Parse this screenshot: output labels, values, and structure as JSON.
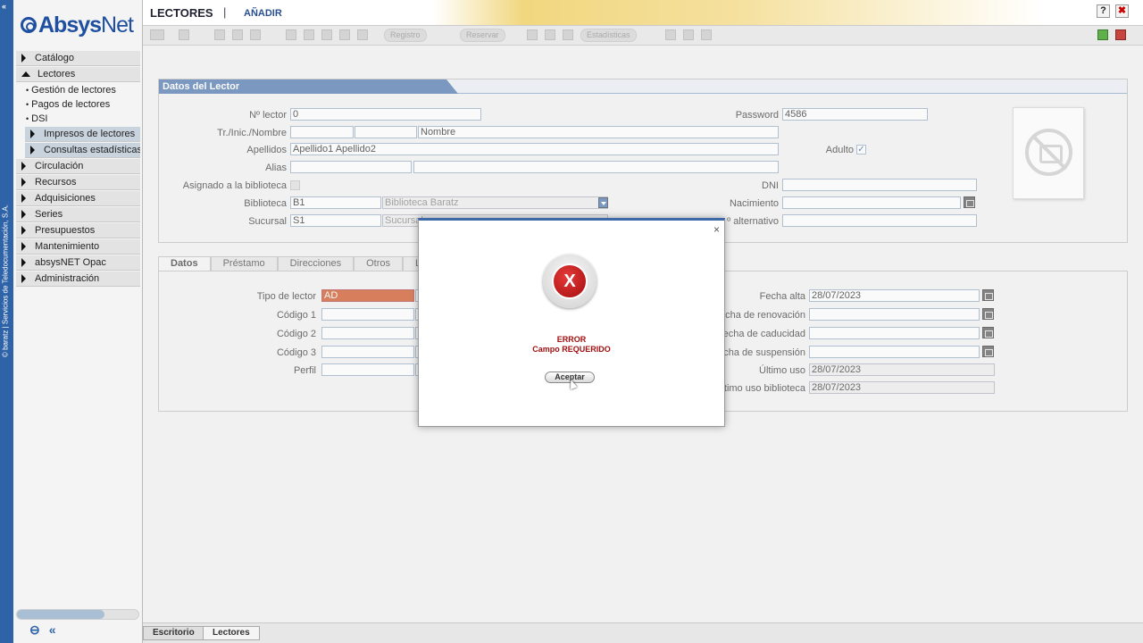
{
  "app": {
    "logo_prefix": "Absys",
    "logo_suffix": "Net",
    "vertical_credit": "© baratz | Servicios de Teledocumentación, S.A."
  },
  "header": {
    "module": "LECTORES",
    "separator": "|",
    "action": "AÑADIR",
    "help": "?",
    "close": "✖"
  },
  "toolbar": {
    "buttons": [
      "Registro",
      "Reservar",
      "Estadísticas"
    ]
  },
  "sidebar": {
    "items": [
      {
        "label": "Catálogo",
        "expanded": false
      },
      {
        "label": "Lectores",
        "expanded": true
      },
      {
        "label": "Circulación",
        "expanded": false
      },
      {
        "label": "Recursos",
        "expanded": false
      },
      {
        "label": "Adquisiciones",
        "expanded": false
      },
      {
        "label": "Series",
        "expanded": false
      },
      {
        "label": "Presupuestos",
        "expanded": false
      },
      {
        "label": "Mantenimiento",
        "expanded": false
      },
      {
        "label": "absysNET Opac",
        "expanded": false
      },
      {
        "label": "Administración",
        "expanded": false
      }
    ],
    "lectores_sub": [
      "Gestión de lectores",
      "Pagos de lectores",
      "DSI"
    ],
    "dsi_sub": [
      "Impresos de lectores",
      "Consultas estadísticas de lectores"
    ]
  },
  "reader_panel": {
    "title": "Datos del Lector",
    "labels": {
      "n_lector": "Nº lector",
      "password": "Password",
      "tr_inic_nombre": "Tr./Inic./Nombre",
      "apellidos": "Apellidos",
      "adulto": "Adulto",
      "alias": "Alias",
      "asignado": "Asignado a la biblioteca",
      "dni": "DNI",
      "biblioteca": "Biblioteca",
      "nacimiento": "Nacimiento",
      "sucursal": "Sucursal",
      "alternativo": "º alternativo"
    },
    "values": {
      "n_lector": "0",
      "password": "4586",
      "tr": "",
      "inic": "",
      "nombre": "Nombre",
      "apellidos": "Apellido1 Apellido2",
      "alias1": "",
      "alias2": "",
      "dni": "",
      "biblioteca_code": "B1",
      "biblioteca_name": "Biblioteca Baratz",
      "nacimiento": "",
      "sucursal_code": "S1",
      "sucursal_name": "Sucursal",
      "alternativo": "",
      "adulto_checked": "✓",
      "asignado_checked": ""
    }
  },
  "tabs": [
    "Datos",
    "Préstamo",
    "Direcciones",
    "Otros",
    "Lista"
  ],
  "datos_panel": {
    "labels": {
      "tipo_lector": "Tipo de lector",
      "codigo1": "Código 1",
      "codigo2": "Código 2",
      "codigo3": "Código 3",
      "perfil": "Perfil",
      "fecha_alta": "Fecha alta",
      "fecha_renovacion": "echa de renovación",
      "fecha_caducidad": "echa de caducidad",
      "fecha_suspension": "echa de suspensión",
      "ultimo_uso": "Último uso",
      "ultimo_uso_biblioteca": "timo uso biblioteca"
    },
    "values": {
      "tipo_lector": "AD",
      "tipo_lector_name": "A",
      "codigo1": "",
      "codigo2": "",
      "codigo3": "",
      "perfil": "",
      "fecha_alta": "28/07/2023",
      "fecha_renovacion": "",
      "fecha_caducidad": "",
      "fecha_suspension": "",
      "ultimo_uso": "28/07/2023",
      "ultimo_uso_biblioteca": "28/07/2023"
    }
  },
  "statusbar": {
    "tabs": [
      "Escritorio",
      "Lectores"
    ]
  },
  "dialog": {
    "close": "×",
    "icon": "X",
    "title": "ERROR",
    "message": "Campo REQUERIDO",
    "ok": "Aceptar"
  },
  "colors": {
    "brand_blue": "#2f63a8",
    "required_field": "#c9420e",
    "error_red": "#a01010"
  }
}
